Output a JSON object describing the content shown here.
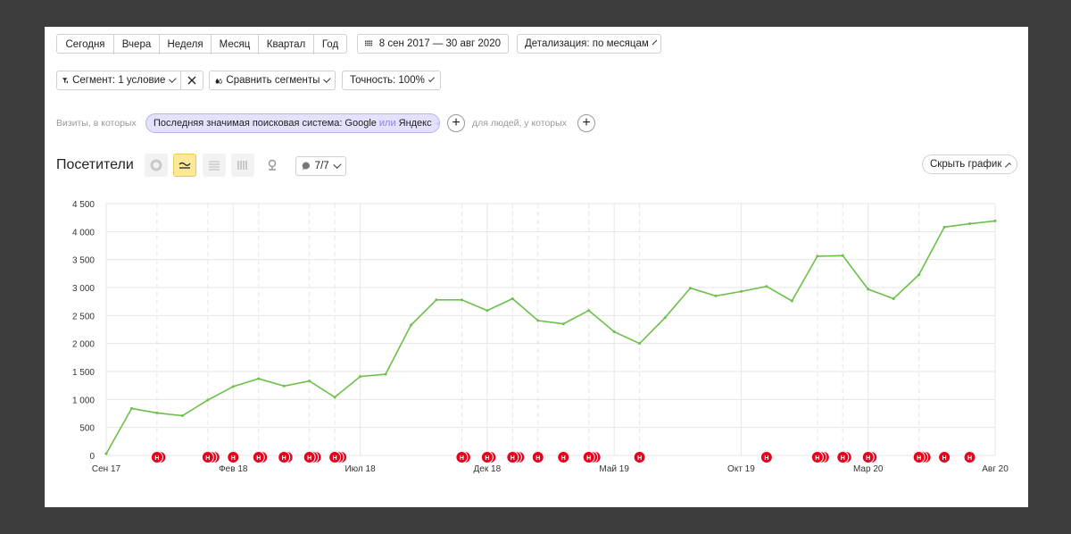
{
  "toolbar": {
    "periods": [
      "Сегодня",
      "Вчера",
      "Неделя",
      "Месяц",
      "Квартал",
      "Год"
    ],
    "date_range": "8 сен 2017 — 30 авг 2020",
    "detail": "Детализация: по месяцам"
  },
  "filters": {
    "segment": "Сегмент: 1 условие",
    "compare": "Сравнить сегменты",
    "accuracy": "Точность: 100%"
  },
  "condition": {
    "prefix": "Визиты, в которых",
    "chip_main": "Последняя значимая поисковая система: Google",
    "chip_or": "или",
    "chip_end": "Яндекс",
    "people": "для людей, у которых"
  },
  "chart_header": {
    "title": "Посетители",
    "notes_count": "7/7",
    "hide_label": "Скрыть график"
  },
  "colors": {
    "line": "#6cc04a",
    "marker": "#e8001c",
    "active_view": "#fde89a",
    "chip_bg": "#e3e1fb"
  },
  "chart_data": {
    "type": "line",
    "title": "",
    "xlabel": "",
    "ylabel": "",
    "ylim": [
      0,
      4500
    ],
    "yticks": [
      0,
      500,
      1000,
      1500,
      2000,
      2500,
      3000,
      3500,
      4000,
      4500
    ],
    "ytick_labels": [
      "0",
      "500",
      "1 000",
      "1 500",
      "2 000",
      "2 500",
      "3 000",
      "3 500",
      "4 000",
      "4 500"
    ],
    "x_tick_labels": [
      "Сен 17",
      "Фев 18",
      "Июл 18",
      "Дек 18",
      "Май 19",
      "Окт 19",
      "Мар 20",
      "Авг 20"
    ],
    "x_tick_index": [
      0,
      5,
      10,
      15,
      20,
      25,
      30,
      35
    ],
    "grid": true,
    "series": [
      {
        "values": [
          30,
          840,
          760,
          710,
          990,
          1230,
          1370,
          1240,
          1330,
          1040,
          1410,
          1450,
          2330,
          2780,
          2780,
          2590,
          2800,
          2410,
          2350,
          2590,
          2210,
          2000,
          2460,
          2990,
          2850,
          2930,
          3020,
          2760,
          3560,
          3570,
          2970,
          2800,
          3230,
          4080,
          4140,
          4190
        ]
      }
    ],
    "annotation_marker": "Н",
    "annotation_groups": [
      {
        "month": 2,
        "count": 2
      },
      {
        "month": 4,
        "count": 3
      },
      {
        "month": 5,
        "count": 1
      },
      {
        "month": 6,
        "count": 2
      },
      {
        "month": 7,
        "count": 2
      },
      {
        "month": 8,
        "count": 3
      },
      {
        "month": 9,
        "count": 3
      },
      {
        "month": 14,
        "count": 2
      },
      {
        "month": 15,
        "count": 2
      },
      {
        "month": 16,
        "count": 3
      },
      {
        "month": 17,
        "count": 1
      },
      {
        "month": 18,
        "count": 1
      },
      {
        "month": 19,
        "count": 3
      },
      {
        "month": 21,
        "count": 1
      },
      {
        "month": 26,
        "count": 1
      },
      {
        "month": 28,
        "count": 3
      },
      {
        "month": 29,
        "count": 2
      },
      {
        "month": 30,
        "count": 2
      },
      {
        "month": 32,
        "count": 3
      },
      {
        "month": 33,
        "count": 1
      },
      {
        "month": 34,
        "count": 1
      }
    ],
    "dashed_gridlines_at_months": [
      2,
      4,
      6,
      8,
      9,
      14,
      16,
      17,
      19,
      21,
      28,
      29,
      30,
      32
    ]
  }
}
